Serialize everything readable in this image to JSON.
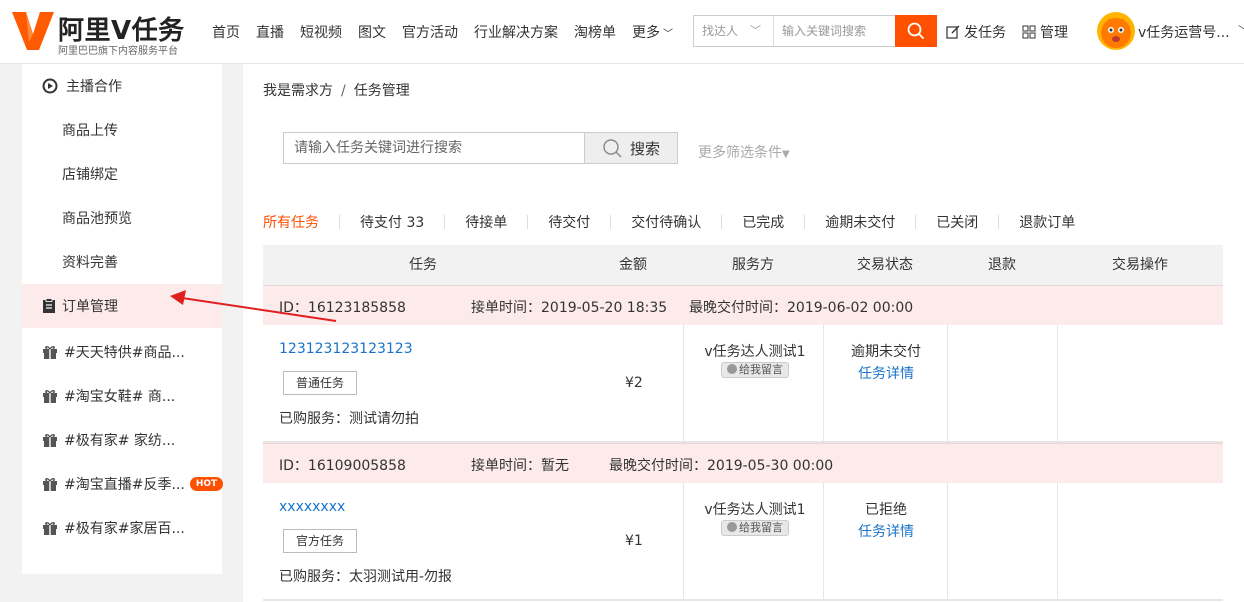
{
  "header": {
    "brand": "阿里V任务",
    "slogan": "阿里巴巴旗下内容服务平台",
    "nav": [
      "首页",
      "直播",
      "短视频",
      "图文",
      "官方活动",
      "行业解决方案",
      "淘榜单",
      "更多"
    ],
    "search": {
      "type_label": "找达人",
      "placeholder": "输入关键词搜索"
    },
    "publish_task": "发任务",
    "manage": "管理",
    "user_name": "v任务运营号..."
  },
  "sidebar": {
    "group_title": "主播合作",
    "sub_items": [
      "商品上传",
      "店铺绑定",
      "商品池预览",
      "资料完善"
    ],
    "active_item": "订单管理",
    "campaigns": [
      "#天天特供#商品...",
      "#淘宝女鞋# 商...",
      "#极有家# 家纺...",
      "#淘宝直播#反季...",
      "#极有家#家居百..."
    ],
    "hot_badge": "HOT"
  },
  "main": {
    "breadcrumb": {
      "parent": "我是需求方",
      "separator": "/",
      "current": "任务管理"
    },
    "task_search": {
      "placeholder": "请输入任务关键词进行搜索",
      "button": "搜索"
    },
    "more_filters": "更多筛选条件",
    "tabs": [
      "所有任务",
      "待支付 33",
      "待接单",
      "待交付",
      "交付待确认",
      "已完成",
      "逾期未交付",
      "已关闭",
      "退款订单"
    ],
    "table_headers": [
      "任务",
      "金额",
      "服务方",
      "交易状态",
      "退款",
      "交易操作"
    ],
    "orders": [
      {
        "id": "ID：16123185858",
        "accept_time": "接单时间：2019-05-20 18:35",
        "deadline": "最晚交付时间：2019-06-02 00:00",
        "task_name": "123123123123123",
        "task_tag": "普通任务",
        "bought": "已购服务：测试请勿拍",
        "amount": "¥2",
        "provider": "v任务达人测试1",
        "message": "给我留言",
        "status": "逾期未交付",
        "detail": "任务详情"
      },
      {
        "id": "ID：16109005858",
        "accept_time": "接单时间：暂无",
        "deadline": "最晚交付时间：2019-05-30 00:00",
        "task_name": "xxxxxxxx",
        "task_tag": "官方任务",
        "bought": "已购服务：太羽测试用-勿报",
        "amount": "¥1",
        "provider": "v任务达人测试1",
        "message": "给我留言",
        "status": "已拒绝",
        "detail": "任务详情"
      }
    ]
  },
  "colors": {
    "accent": "#ff5000",
    "link": "#1a73c8",
    "active_bg": "#fdebeb",
    "arrow": "#e02020"
  }
}
